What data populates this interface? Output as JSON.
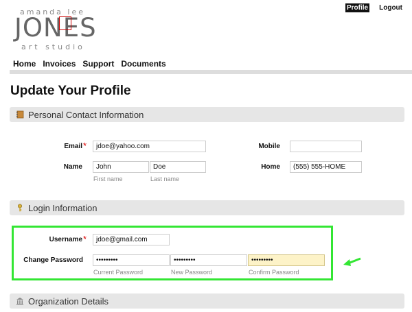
{
  "logo": {
    "top": "amanda lee",
    "main": "JONES",
    "bottom": "art studio"
  },
  "top_links": {
    "profile": "Profile",
    "logout": "Logout"
  },
  "nav": [
    "Home",
    "Invoices",
    "Support",
    "Documents"
  ],
  "page_title": "Update Your Profile",
  "sections": {
    "contact": "Personal Contact Information",
    "login": "Login Information",
    "org": "Organization Details"
  },
  "contact": {
    "email_label": "Email",
    "email_value": "jdoe@yahoo.com",
    "mobile_label": "Mobile",
    "mobile_value": "",
    "name_label": "Name",
    "first_name": "John",
    "last_name": "Doe",
    "first_hint": "First name",
    "last_hint": "Last name",
    "home_label": "Home",
    "home_value": "(555) 555-HOME"
  },
  "login": {
    "username_label": "Username",
    "username_value": "jdoe@gmail.com",
    "change_password_label": "Change Password",
    "current_password": "•••••••••",
    "new_password": "•••••••••",
    "confirm_password": "•••••••••",
    "current_hint": "Current Password",
    "new_hint": "New Password",
    "confirm_hint": "Confirm Password"
  },
  "required_mark": "*",
  "colors": {
    "highlight": "#33e633",
    "required": "#dd0000",
    "focus": "#fdf3c8"
  }
}
